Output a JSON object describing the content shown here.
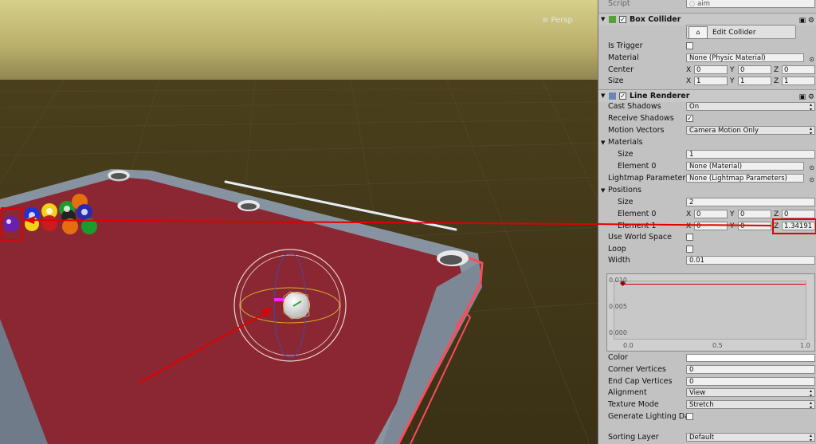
{
  "scene": {
    "persp_label": "Persp",
    "gizmo_icon": "scene-gizmo-icon"
  },
  "inspector": {
    "script_label": "Script",
    "script_value": "aim",
    "box_collider": {
      "title": "Box Collider",
      "edit_collider": "Edit Collider",
      "is_trigger": "Is Trigger",
      "material_label": "Material",
      "material_value": "None (Physic Material)",
      "center_label": "Center",
      "center": {
        "x": "0",
        "y": "0",
        "z": "0"
      },
      "size_label": "Size",
      "size": {
        "x": "1",
        "y": "1",
        "z": "1"
      }
    },
    "line_renderer": {
      "title": "Line Renderer",
      "cast_shadows_label": "Cast Shadows",
      "cast_shadows_value": "On",
      "receive_shadows_label": "Receive Shadows",
      "motion_vectors_label": "Motion Vectors",
      "motion_vectors_value": "Camera Motion Only",
      "materials_label": "Materials",
      "materials_size_label": "Size",
      "materials_size_value": "1",
      "element0_label": "Element 0",
      "element0_value": "None (Material)",
      "lightmap_label": "Lightmap Parameter",
      "lightmap_value": "None (Lightmap Parameters)",
      "positions_label": "Positions",
      "positions_size_label": "Size",
      "positions_size_value": "2",
      "pos_element0_label": "Element 0",
      "pos_element0": {
        "x": "0",
        "y": "0",
        "z": "0"
      },
      "pos_element1_label": "Element 1",
      "pos_element1": {
        "x": "0",
        "y": "0",
        "z": "1.34191"
      },
      "use_world_space_label": "Use World Space",
      "loop_label": "Loop",
      "width_label": "Width",
      "width_value": "0.01",
      "curve": {
        "y_labels": [
          "0.010",
          "0.005",
          "0.000"
        ],
        "x_labels": [
          "0.0",
          "0.5",
          "1.0"
        ]
      },
      "color_label": "Color",
      "corner_vertices_label": "Corner Vertices",
      "corner_vertices_value": "0",
      "end_cap_label": "End Cap Vertices",
      "end_cap_value": "0",
      "alignment_label": "Alignment",
      "alignment_value": "View",
      "texture_mode_label": "Texture Mode",
      "texture_mode_value": "Stretch",
      "gen_lighting_label": "Generate Lighting Da",
      "sorting_layer_label": "Sorting Layer",
      "sorting_layer_value": "Default"
    },
    "axis_letters": {
      "x": "X",
      "y": "Y",
      "z": "Z"
    },
    "colors": {
      "annotation_red": "#e00000",
      "felt": "#8a2733",
      "panel": "#c2c2c2"
    }
  }
}
